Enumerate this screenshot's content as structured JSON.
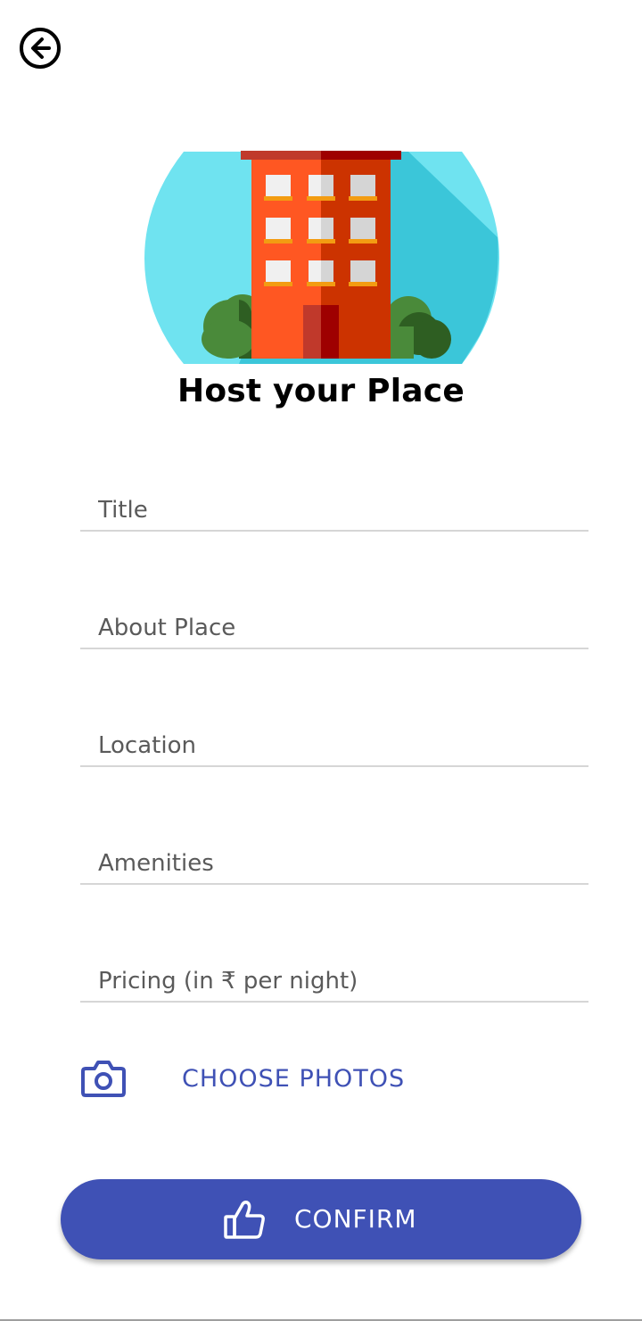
{
  "header": {
    "back_icon": "arrow-left-circle-icon"
  },
  "hero": {
    "illustration": "building-illustration",
    "colors": {
      "sky": "#6fe3f0",
      "sky_shadow": "#3bc6d9",
      "building": "#ff5722",
      "building_shade": "#cc3300",
      "roof": "#c0392b",
      "window": "#e0e0e0",
      "sill": "#f39c12",
      "tree": "#4a8a3a",
      "tree_shade": "#2e5e22",
      "door": "#9e0000"
    }
  },
  "page": {
    "title": "Host your Place"
  },
  "form": {
    "title_placeholder": "Title",
    "about_placeholder": "About Place",
    "location_placeholder": "Location",
    "amenities_placeholder": "Amenities",
    "pricing_placeholder": "Pricing (in ₹ per night)"
  },
  "photos": {
    "label": "CHOOSE PHOTOS",
    "icon": "camera-icon"
  },
  "confirm": {
    "label": "CONFIRM",
    "icon": "thumbs-up-icon"
  },
  "colors": {
    "accent": "#3f51b5",
    "field_underline": "#d6d6d6",
    "placeholder": "#5a5a5a"
  }
}
